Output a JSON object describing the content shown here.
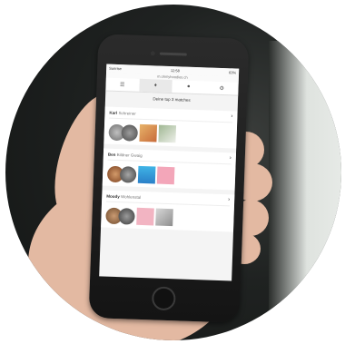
{
  "status": {
    "carrier": "Sunrise",
    "time": "12:58",
    "battery": "63%"
  },
  "url": "m.ohmyhoodies.ch",
  "tabs": [
    {
      "icon": "menu-icon"
    },
    {
      "icon": "heart-icon",
      "active": true
    },
    {
      "icon": "profile-icon"
    },
    {
      "icon": "settings-icon"
    }
  ],
  "heading": "Deine top 3 matches",
  "matches": [
    {
      "name": "Karl",
      "subtitle": "Schreiner"
    },
    {
      "name": "Ben",
      "subtitle": "Bildner Gwaig"
    },
    {
      "name": "Moody",
      "subtitle": "Wohlenstal"
    }
  ]
}
